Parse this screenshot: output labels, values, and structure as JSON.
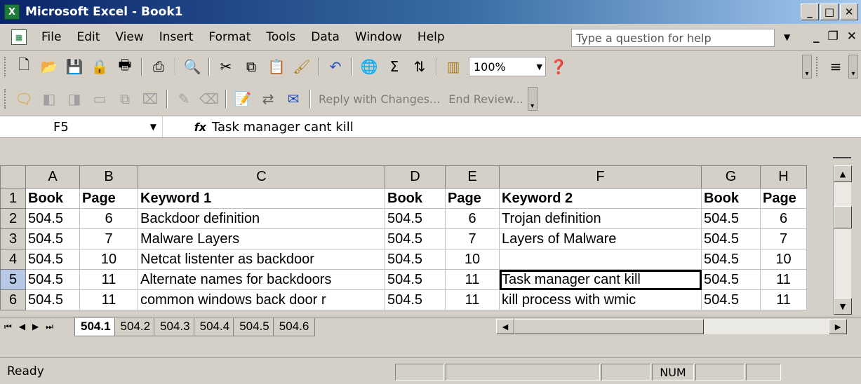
{
  "window": {
    "title": "Microsoft Excel - Book1",
    "app_icon": "X"
  },
  "menu": {
    "items": [
      "File",
      "Edit",
      "View",
      "Insert",
      "Format",
      "Tools",
      "Data",
      "Window",
      "Help"
    ],
    "help_placeholder": "Type a question for help"
  },
  "toolbar": {
    "zoom": "100%"
  },
  "review_toolbar": {
    "reply_label": "Reply with Changes...",
    "end_review_label": "End Review..."
  },
  "formula_bar": {
    "name_box": "F5",
    "fx": "fx",
    "content": "Task manager cant kill"
  },
  "sheet": {
    "columns": [
      "A",
      "B",
      "C",
      "D",
      "E",
      "F",
      "G",
      "H"
    ],
    "rows": [
      {
        "num": "1",
        "cells": [
          "Book",
          "Page",
          "Keyword 1",
          "Book",
          "Page",
          "Keyword 2",
          "Book",
          "Page"
        ]
      },
      {
        "num": "2",
        "cells": [
          "504.5",
          "6",
          "Backdoor definition",
          "504.5",
          "6",
          "Trojan definition",
          "504.5",
          "6"
        ]
      },
      {
        "num": "3",
        "cells": [
          "504.5",
          "7",
          "Malware Layers",
          "504.5",
          "7",
          "Layers of Malware",
          "504.5",
          "7"
        ]
      },
      {
        "num": "4",
        "cells": [
          "504.5",
          "10",
          "Netcat listenter as backdoor",
          "504.5",
          "10",
          "",
          "504.5",
          "10"
        ]
      },
      {
        "num": "5",
        "cells": [
          "504.5",
          "11",
          "Alternate names for backdoors",
          "504.5",
          "11",
          "Task manager cant kill",
          "504.5",
          "11"
        ]
      },
      {
        "num": "6",
        "cells": [
          "504.5",
          "11",
          "common windows back door r",
          "504.5",
          "11",
          "kill process with wmic",
          "504.5",
          "11"
        ]
      }
    ],
    "active_cell": "F5"
  },
  "sheet_tabs": [
    "504.1",
    "504.2",
    "504.3",
    "504.4",
    "504.5",
    "504.6"
  ],
  "status": {
    "ready": "Ready",
    "num": "NUM"
  }
}
